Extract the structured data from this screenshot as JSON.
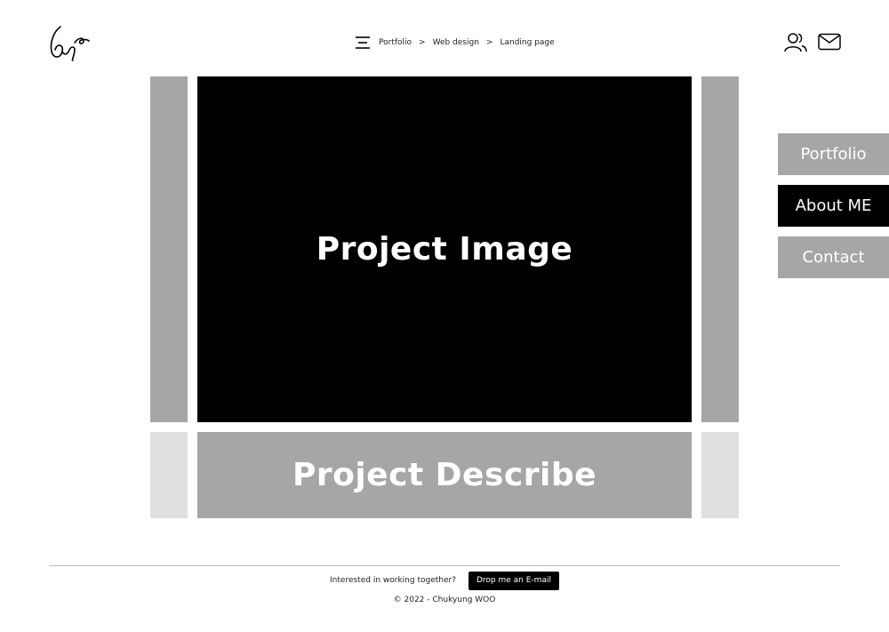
{
  "header": {
    "logo_icon": "signature-logo-icon",
    "menu_icon": "hamburger-menu-icon",
    "breadcrumb": [
      {
        "label": "Portfolio"
      },
      {
        "label": "Web design"
      },
      {
        "label": "Landing page"
      }
    ],
    "breadcrumb_separator": ">",
    "user_icon": "user-icon",
    "mail_icon": "mail-icon"
  },
  "main": {
    "image_label": "Project Image",
    "describe_label": "Project Describe"
  },
  "side_menu": {
    "items": [
      {
        "label": "Portfolio",
        "state": "inactive"
      },
      {
        "label": "About ME",
        "state": "active"
      },
      {
        "label": "Contact",
        "state": "inactive"
      }
    ]
  },
  "footer": {
    "prompt": "Interested in working together?",
    "cta_label": "Drop me an E-mail",
    "copyright": "© 2022 - Chukyung WOO"
  },
  "colors": {
    "accent": "#000000",
    "gray": "#a6a6a6",
    "light_gray": "#e0e0e0",
    "background": "#ffffff"
  }
}
